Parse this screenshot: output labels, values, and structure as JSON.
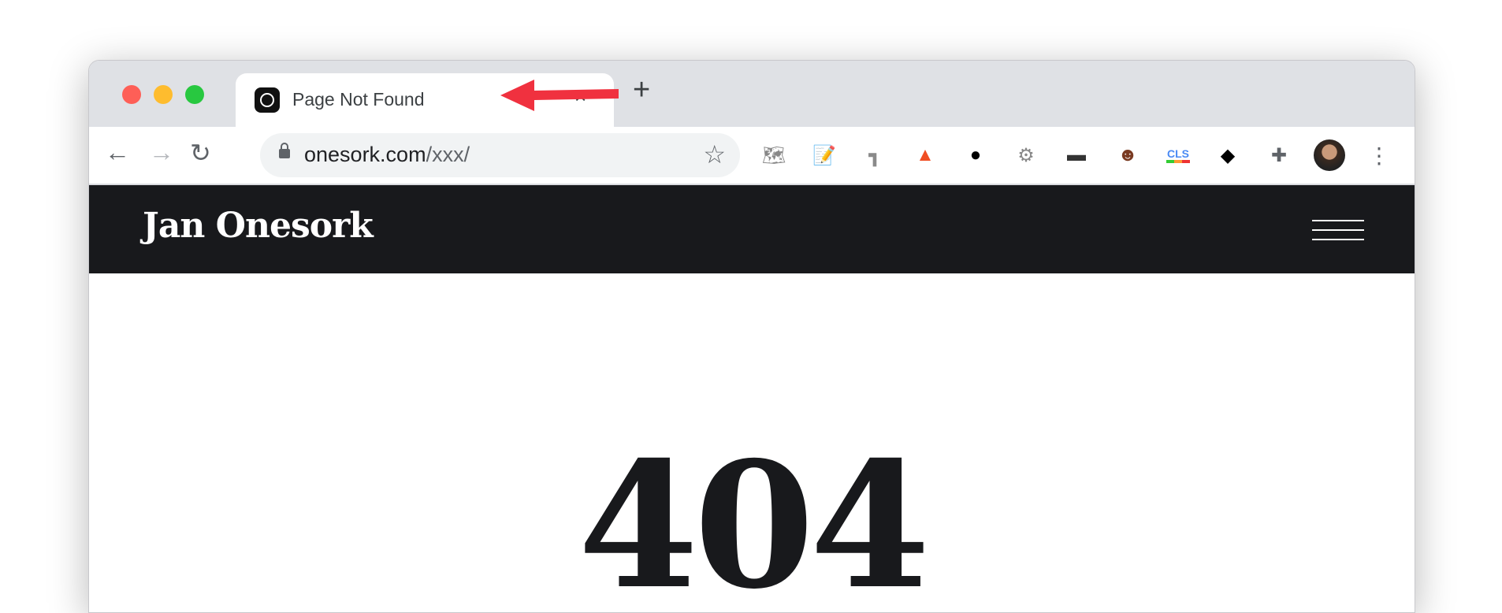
{
  "tab": {
    "title": "Page Not Found",
    "favicon": "circle-logo-icon",
    "close": "×",
    "new_tab": "+"
  },
  "toolbar": {
    "back": "←",
    "forward": "→",
    "reload": "↻",
    "url_domain": "onesork.com",
    "url_path": "/xxx/",
    "extensions": [
      "map-extension-icon",
      "text-edit-extension-icon",
      "analytics-extension-icon",
      "lighthouse-icon",
      "ninja-pin-icon",
      "gear-extension-icon",
      "mask-doc-extension-icon",
      "bearded-man-extension-icon",
      "cls-extension-icon",
      "layers-extension-icon",
      "puzzle-icon"
    ],
    "cls_label": "CLS"
  },
  "site": {
    "brand": "Jan Onesork",
    "heading": "404"
  },
  "colors": {
    "navbar": "#18191c",
    "arrow": "#f0313f",
    "tabbar": "#dfe1e5"
  }
}
